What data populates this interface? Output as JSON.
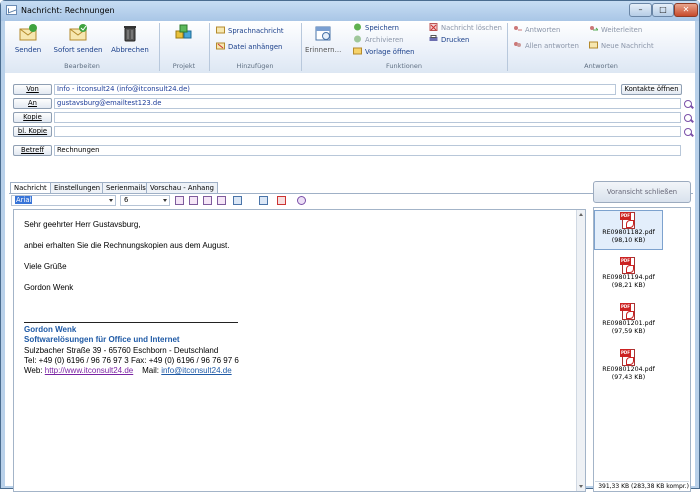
{
  "window": {
    "title": "Nachricht: Rechnungen",
    "controls": {
      "minimize": "–",
      "maximize": "□",
      "close": "✕"
    }
  },
  "ribbon": {
    "groups": {
      "bearbeiten": "Bearbeiten",
      "projekt": "Projekt",
      "hinzufuegen": "Hinzufügen",
      "funktionen": "Funktionen",
      "antworten": "Antworten"
    },
    "buttons": {
      "senden": "Senden",
      "sofort_senden": "Sofort senden",
      "abbrechen": "Abbrechen",
      "sprachnachricht": "Sprachnachricht",
      "datei_anhaengen": "Datei anhängen",
      "erinnern": "Erinnern...",
      "speichern": "Speichern",
      "archivieren": "Archivieren",
      "vorlage_oeffnen": "Vorlage öffnen",
      "nachricht_loeschen": "Nachricht löschen",
      "drucken": "Drucken",
      "antworten": "Antworten",
      "allen_antworten": "Allen antworten",
      "weiterleiten": "Weiterleiten",
      "neue_nachricht": "Neue Nachricht"
    }
  },
  "header": {
    "von_label": "Von",
    "von_value": "Info - itconsult24 (info@itconsult24.de)",
    "kontakte_button": "Kontakte öffnen",
    "an_label": "An",
    "an_value": "gustavsburg@emailtest123.de",
    "kopie_label": "Kopie",
    "kopie_value": "",
    "blkopie_label": "bl. Kopie",
    "blkopie_value": "",
    "betreff_label": "Betreff",
    "betreff_value": "Rechnungen"
  },
  "tabs": [
    "Nachricht",
    "Einstellungen",
    "Serienmails",
    "Vorschau - Anhang"
  ],
  "format": {
    "font": "Arial",
    "size": "6"
  },
  "body": {
    "greeting": "Sehr geehrter Herr Gustavsburg,",
    "line1": "anbei erhalten Sie die Rechnungskopien aus dem August.",
    "closing": "Viele Grüße",
    "sender": "Gordon Wenk"
  },
  "signature": {
    "name": "Gordon Wenk",
    "company": "Softwarelösungen für Office und Internet",
    "address": "Sulzbacher Straße 39   -   65760 Eschborn   -   Deutschland",
    "phone": "Tel: +49 (0) 6196 / 96 76 97 3    Fax: +49 (0) 6196 / 96 76 97 6",
    "web_label": "Web: ",
    "web": "http://www.itconsult24.de",
    "mail_label": "    Mail: ",
    "mail": "info@itconsult24.de"
  },
  "preview": {
    "close_button": "Voransicht schließen"
  },
  "attachments": [
    {
      "name": "RE09801182.pdf",
      "size": "(98,10 KB)"
    },
    {
      "name": "RE09801194.pdf",
      "size": "(98,21 KB)"
    },
    {
      "name": "RE09801201.pdf",
      "size": "(97,59 KB)"
    },
    {
      "name": "RE09801204.pdf",
      "size": "(97,43 KB)"
    }
  ],
  "attachments_total": "391,33 KB (283,38 KB kompr.)",
  "colors": {
    "link": "#1f5aa6",
    "visited_link": "#7a23a3",
    "ribbon_text": "#1a3f8a"
  }
}
